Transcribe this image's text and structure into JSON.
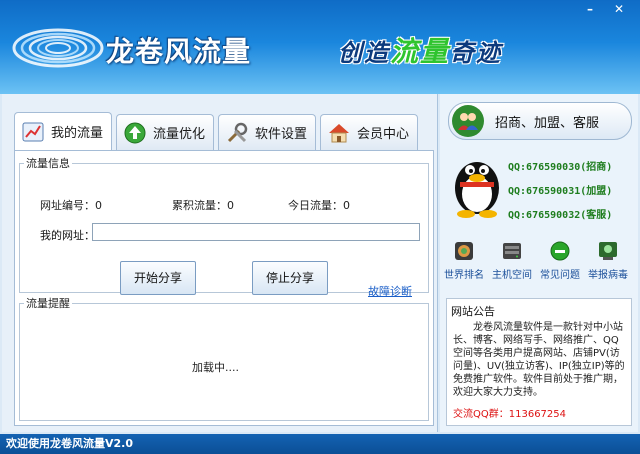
{
  "header": {
    "app_title": "龙卷风流量",
    "slogan_parts": [
      "创造",
      "流量",
      "奇迹"
    ]
  },
  "window_controls": {
    "minimize": "–",
    "close": "✕"
  },
  "tabs": [
    {
      "label": "我的流量",
      "icon": "chart-icon",
      "active": true
    },
    {
      "label": "流量优化",
      "icon": "upload-arrow-icon",
      "active": false
    },
    {
      "label": "软件设置",
      "icon": "tools-icon",
      "active": false
    },
    {
      "label": "会员中心",
      "icon": "home-icon",
      "active": false
    }
  ],
  "traffic_info": {
    "legend": "流量信息",
    "url_id": "网址编号：0",
    "total_traffic": "累积流量：0",
    "today_traffic": "今日流量：0",
    "url_label": "我的网址：",
    "url_value": "",
    "start_button": "开始分享",
    "stop_button": "停止分享",
    "diagnose_link": "故障诊断"
  },
  "traffic_reminder": {
    "legend": "流量提醒",
    "loading_text": "加载中...."
  },
  "contact": {
    "label": "招商、加盟、客服",
    "qq": [
      "QQ:676590030(招商)",
      "QQ:676590031(加盟)",
      "QQ:676590032(客服)"
    ]
  },
  "quick_links": [
    {
      "label": "世界排名",
      "icon": "globe-rank-icon"
    },
    {
      "label": "主机空间",
      "icon": "server-icon"
    },
    {
      "label": "常见问题",
      "icon": "help-icon"
    },
    {
      "label": "举报病毒",
      "icon": "report-virus-icon"
    }
  ],
  "notice": {
    "title": "网站公告",
    "body": "龙卷风流量软件是一款针对中小站长、博客、网络写手、网络推广、QQ空间等各类用户提高网站、店铺PV(访问量)、UV(独立访客)、IP(独立IP)等的免费推广软件。软件目前处于推广期，欢迎大家大力支持。",
    "qq_group": "交流QQ群：113667254"
  },
  "status_bar": {
    "text": "欢迎使用龙卷风流量V2.0"
  },
  "colors": {
    "header_top": "#0f6cc6",
    "header_bottom": "#6cc2f4",
    "accent_green": "#2fc42f",
    "qq_green": "#1e7d1e",
    "link_blue": "#1b5fc8",
    "status_bar": "#0b4f96"
  }
}
